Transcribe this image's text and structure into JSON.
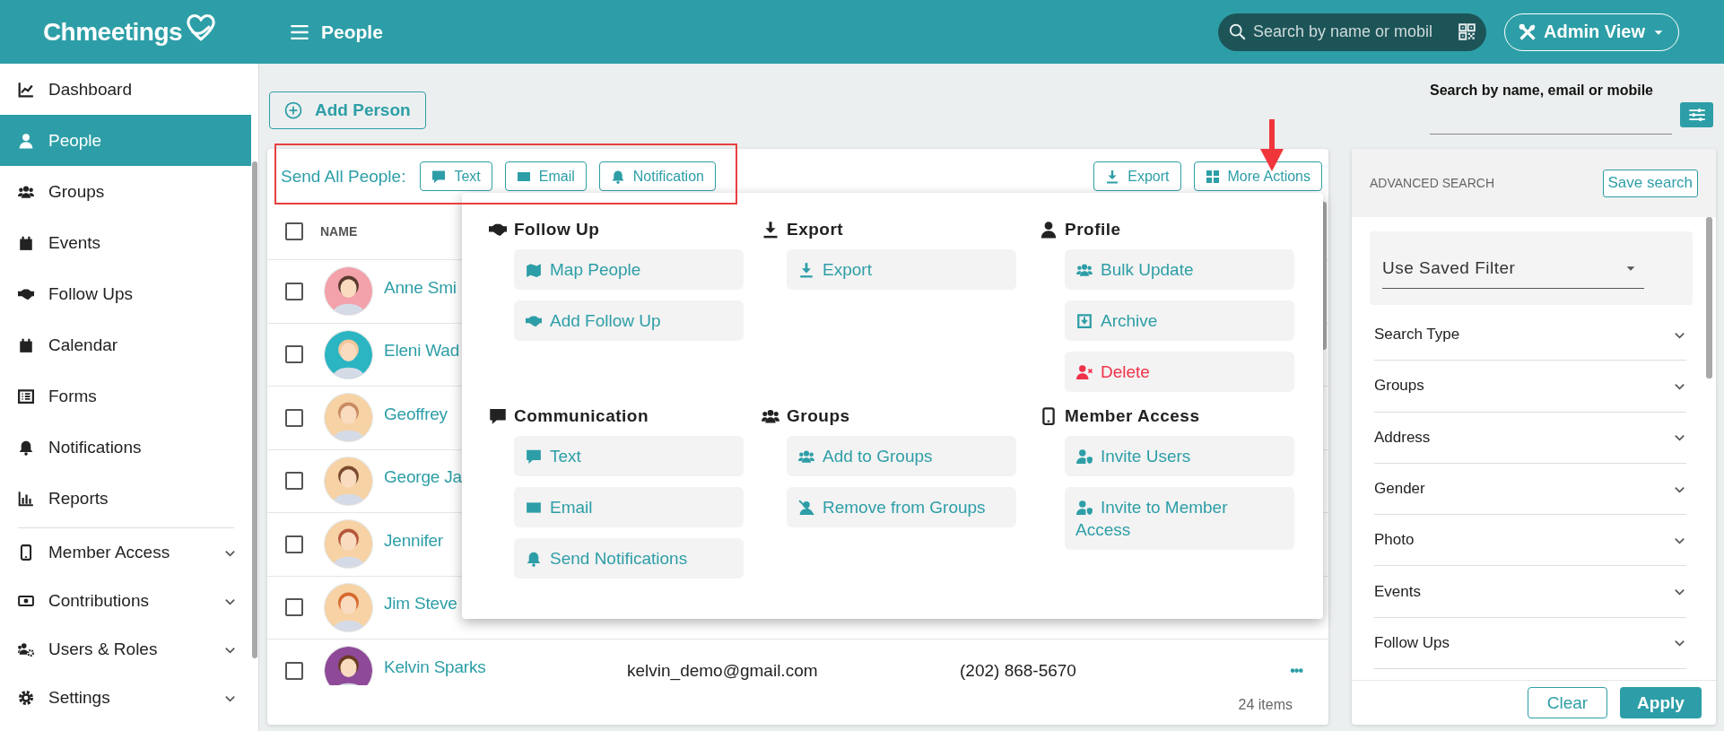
{
  "app": {
    "logo": "Chmeetings"
  },
  "header": {
    "title": "People",
    "search_placeholder": "Search by name or mobil",
    "role_button": "Admin View"
  },
  "sidebar": {
    "items": [
      {
        "label": "Dashboard",
        "selected": false,
        "has_submenu": false
      },
      {
        "label": "People",
        "selected": true,
        "has_submenu": false
      },
      {
        "label": "Groups",
        "selected": false,
        "has_submenu": false
      },
      {
        "label": "Events",
        "selected": false,
        "has_submenu": false
      },
      {
        "label": "Follow Ups",
        "selected": false,
        "has_submenu": false
      },
      {
        "label": "Calendar",
        "selected": false,
        "has_submenu": false
      },
      {
        "label": "Forms",
        "selected": false,
        "has_submenu": false
      },
      {
        "label": "Notifications",
        "selected": false,
        "has_submenu": false
      },
      {
        "label": "Reports",
        "selected": false,
        "has_submenu": false
      },
      {
        "label": "Member Access",
        "selected": false,
        "has_submenu": true
      },
      {
        "label": "Contributions",
        "selected": false,
        "has_submenu": true
      },
      {
        "label": "Users & Roles",
        "selected": false,
        "has_submenu": true
      },
      {
        "label": "Settings",
        "selected": false,
        "has_submenu": true
      }
    ]
  },
  "toolbar": {
    "add_button": "Add Person",
    "search_label": "Search by name, email or mobile"
  },
  "people_panel": {
    "send_all_label": "Send All People:",
    "send_buttons": [
      "Text",
      "Email",
      "Notification"
    ],
    "export_button": "Export",
    "more_actions_button": "More Actions",
    "columns": [
      "NAME"
    ],
    "select_all_checked": false,
    "rows": [
      {
        "name": "Anne Smi",
        "checked": false
      },
      {
        "name": "Eleni Wad",
        "checked": false
      },
      {
        "name": "Geoffrey",
        "checked": false
      },
      {
        "name": "George Ja",
        "checked": false
      },
      {
        "name": "Jennifer",
        "checked": false
      },
      {
        "name": "Jim Steve",
        "checked": false
      },
      {
        "name": "Kelvin Sparks",
        "email": "kelvin_demo@gmail.com",
        "phone": "(202) 868-5670",
        "more": "•••",
        "checked": false
      }
    ],
    "item_count": "24 items"
  },
  "more_actions_menu": {
    "sections": [
      {
        "title": "Follow Up",
        "items": [
          {
            "label": "Map People",
            "danger": false
          },
          {
            "label": "Add Follow Up",
            "danger": false
          }
        ]
      },
      {
        "title": "Export",
        "items": [
          {
            "label": "Export",
            "danger": false
          }
        ]
      },
      {
        "title": "Profile",
        "items": [
          {
            "label": "Bulk Update",
            "danger": false
          },
          {
            "label": "Archive",
            "danger": false
          },
          {
            "label": "Delete",
            "danger": true
          }
        ]
      },
      {
        "title": "Communication",
        "items": [
          {
            "label": "Text",
            "danger": false
          },
          {
            "label": "Email",
            "danger": false
          },
          {
            "label": "Send Notifications",
            "danger": false
          }
        ]
      },
      {
        "title": "Groups",
        "items": [
          {
            "label": "Add to Groups",
            "danger": false
          },
          {
            "label": "Remove from Groups",
            "danger": false
          }
        ]
      },
      {
        "title": "Member Access",
        "items": [
          {
            "label": "Invite Users",
            "danger": false
          },
          {
            "label": "Invite to Member Access",
            "danger": false
          }
        ]
      }
    ]
  },
  "advanced_search": {
    "title": "ADVANCED SEARCH",
    "save_button": "Save search",
    "saved_filter": "Use Saved Filter",
    "filters": [
      {
        "label": "Search Type",
        "expanded": false
      },
      {
        "label": "Groups",
        "expanded": false
      },
      {
        "label": "Address",
        "expanded": false
      },
      {
        "label": "Gender",
        "expanded": false
      },
      {
        "label": "Photo",
        "expanded": false
      },
      {
        "label": "Events",
        "expanded": false
      },
      {
        "label": "Follow Ups",
        "expanded": false
      }
    ],
    "clear_button": "Clear",
    "apply_button": "Apply"
  }
}
